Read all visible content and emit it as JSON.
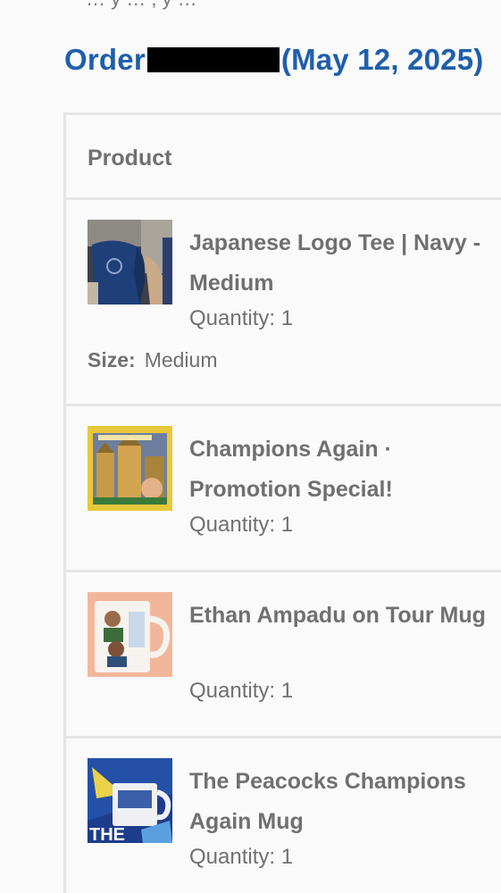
{
  "top_cut_text": "… y … , y …",
  "order": {
    "prefix": "Order",
    "date": "(May 12, 2025)"
  },
  "table": {
    "header": "Product"
  },
  "items": [
    {
      "name": "Japanese Logo Tee | Navy - Medium",
      "quantity": "Quantity: 1",
      "meta_label": "Size:",
      "meta_value": "Medium"
    },
    {
      "name": "Champions Again · Promotion Special!",
      "quantity": "Quantity: 1"
    },
    {
      "name": "Ethan Ampadu on Tour Mug",
      "quantity": "Quantity: 1"
    },
    {
      "name": "The Peacocks Champions Again Mug",
      "quantity": "Quantity: 1"
    }
  ],
  "colors": {
    "accent": "#1f5fab",
    "text": "#707070",
    "border": "#e5e5e5",
    "background": "#fafafa"
  }
}
